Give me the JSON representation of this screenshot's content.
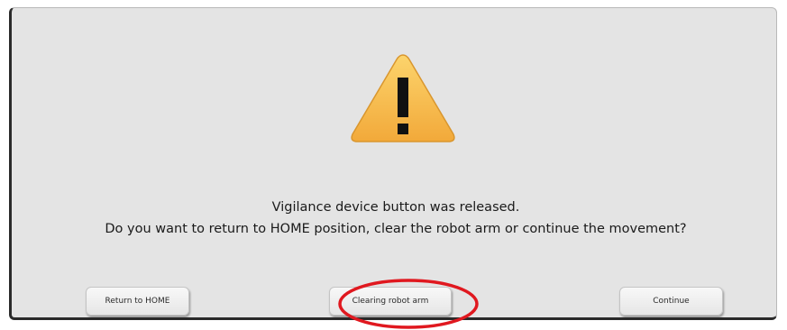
{
  "dialog": {
    "icon": "warning-triangle-icon",
    "icon_colors": {
      "fill": "#f6b93f",
      "mark": "#111111"
    },
    "message_line1": "Vigilance device button was released.",
    "message_line2": "Do you want to return to HOME position, clear the robot arm or continue the movement?"
  },
  "buttons": {
    "return_home_label": "Return to HOME",
    "clear_arm_label": "Clearing robot arm",
    "continue_label": "Continue"
  },
  "annotation": {
    "highlight_color": "#e0181f",
    "highlighted_button": "Clearing robot arm"
  }
}
